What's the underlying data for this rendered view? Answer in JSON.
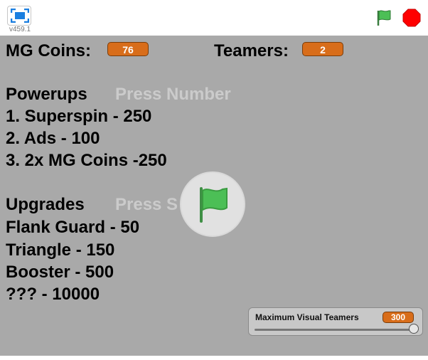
{
  "toolbar": {
    "version": "v459.1",
    "fullscreen_icon": "fullscreen-icon",
    "green_flag_icon": "green-flag-icon",
    "stop_icon": "stop-sign-icon"
  },
  "stage": {
    "mg_coins_label": "MG Coins:",
    "mg_coins_value": "76",
    "teamers_label": "Teamers:",
    "teamers_value": "2",
    "powerups_heading": "Powerups",
    "powerups_hint": "Press Number",
    "powerups": [
      "1. Superspin - 250",
      "2. Ads - 100",
      "3. 2x MG Coins -250"
    ],
    "upgrades_heading": "Upgrades",
    "upgrades_hint": "Press S",
    "upgrades": [
      "Flank Guard - 50",
      "Triangle - 150",
      "Booster - 500",
      "??? - 10000"
    ],
    "slider_monitor": {
      "label": "Maximum Visual Teamers",
      "value": "300",
      "fill_fraction": 1.0
    }
  },
  "colors": {
    "stage_bg": "#a9a9a9",
    "monitor_orange": "#d86d1a",
    "flag_green": "#4cbf56",
    "stop_red": "#ff0000"
  }
}
